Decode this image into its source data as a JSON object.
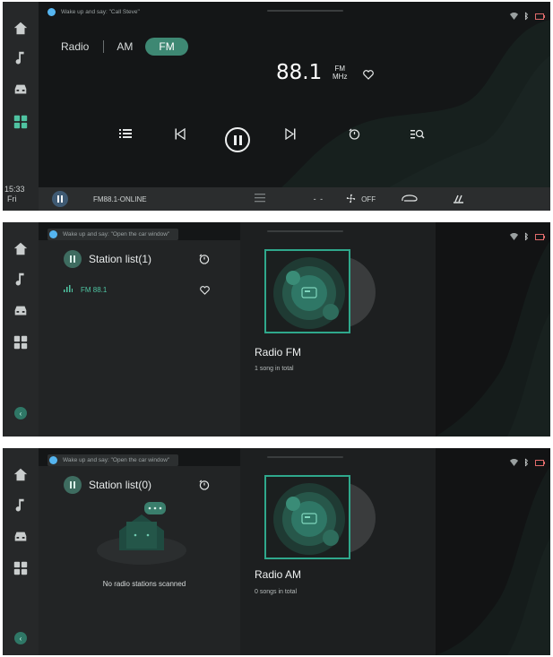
{
  "colors": {
    "accent": "#4fc3a1",
    "panel": "#141617",
    "rail": "#262829"
  },
  "panel1": {
    "voice_hint": "Wake up and say: \"Call Steve\"",
    "tabs": {
      "radio": "Radio",
      "am": "AM",
      "fm": "FM"
    },
    "frequency": "88.1",
    "unit_top": "FM",
    "unit_bottom": "MHz",
    "clock_time": "15:33",
    "clock_day": "Fri",
    "bottom_bar": {
      "station": "FM88.1-ONLINE",
      "temp": "- -",
      "fan": "OFF"
    },
    "icons": [
      "list-icon",
      "previous-icon",
      "pause-icon",
      "next-icon",
      "timer-icon",
      "scan-icon"
    ]
  },
  "panel2": {
    "voice_hint": "Wake up and say: \"Open the car window\"",
    "station_list_title": "Station list(1)",
    "stations": [
      {
        "name": "FM 88.1"
      }
    ],
    "album_title": "Radio FM",
    "album_sub": "1 song in total"
  },
  "panel3": {
    "voice_hint": "Wake up and say: \"Open the car window\"",
    "station_list_title": "Station list(0)",
    "empty_text": "No radio stations scanned",
    "album_title": "Radio AM",
    "album_sub": "0 songs in total"
  }
}
